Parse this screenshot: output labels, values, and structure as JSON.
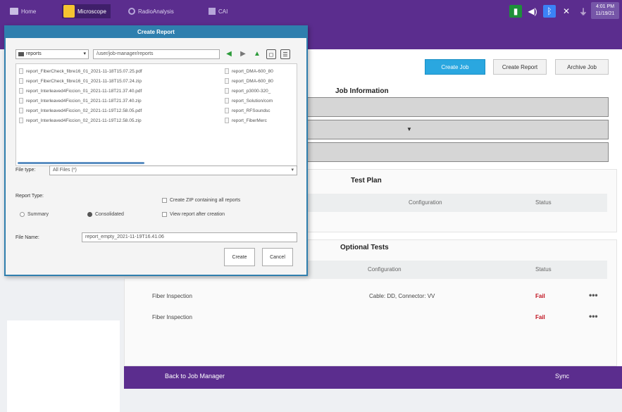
{
  "topbar": {
    "tabs": [
      {
        "label": "Home",
        "icon": "home-icon"
      },
      {
        "label": "Microscope",
        "icon": "microscope-icon"
      },
      {
        "label": "RadioAnalysis",
        "icon": "radio-icon"
      },
      {
        "label": "CAI",
        "icon": "cai-icon"
      }
    ],
    "clock": {
      "time": "4:01 PM",
      "sub": "11/19/21"
    }
  },
  "toolbar": {
    "create_job": "Create Job",
    "create_report": "Create Report",
    "archive_job": "Archive Job"
  },
  "job_information": {
    "title": "Job Information"
  },
  "test_plan": {
    "title": "Test Plan",
    "columns": {
      "configuration": "Configuration",
      "status": "Status"
    }
  },
  "optional_tests": {
    "title": "Optional Tests",
    "columns": {
      "configuration": "Configuration",
      "status": "Status"
    },
    "rows": [
      {
        "name": "Fiber Inspection",
        "configuration": "Cable: DD, Connector: VV",
        "status": "Fail",
        "more": "•••"
      },
      {
        "name": "Fiber Inspection",
        "configuration": "",
        "status": "Fail",
        "more": "•••"
      }
    ]
  },
  "bottombar": {
    "back": "Back to Job Manager",
    "sync": "Sync"
  },
  "dialog": {
    "title": "Create Report",
    "location": "reports",
    "path": "/user/job-manager/reports",
    "files_left": [
      "report_FiberCheck_fibre16_01_2021-11-18T15.07.25.pdf",
      "report_FiberCheck_fibre16_01_2021-11-18T15.07.24.zip",
      "report_Interleaved4Ficcion_01_2021-11-18T21.37.40.pdf",
      "report_Interleaved4Ficcion_01_2021-11-18T21.37.40.zip",
      "report_Interleaved4Ficcion_02_2021-11-19T12.58.05.pdf",
      "report_Interleaved4Ficcion_02_2021-11-19T12.58.05.zip"
    ],
    "files_right": [
      "report_DMA-600_80",
      "report_DMA-600_80",
      "report_p3000-320_",
      "report_Solution/com",
      "report_RFSoundsc",
      "report_FiberMerc"
    ],
    "file_type_label": "File type:",
    "file_type_value": "All Files (*)",
    "report_type_label": "Report Type:",
    "summary_label": "Summary",
    "consolidated_label": "Consolidated",
    "zip_label": "Create ZIP containing all reports",
    "view_label": "View report after creation",
    "file_name_label": "File Name:",
    "file_name_value": "report_empty_2021-11-19T16.41.06",
    "create_label": "Create",
    "cancel_label": "Cancel"
  }
}
